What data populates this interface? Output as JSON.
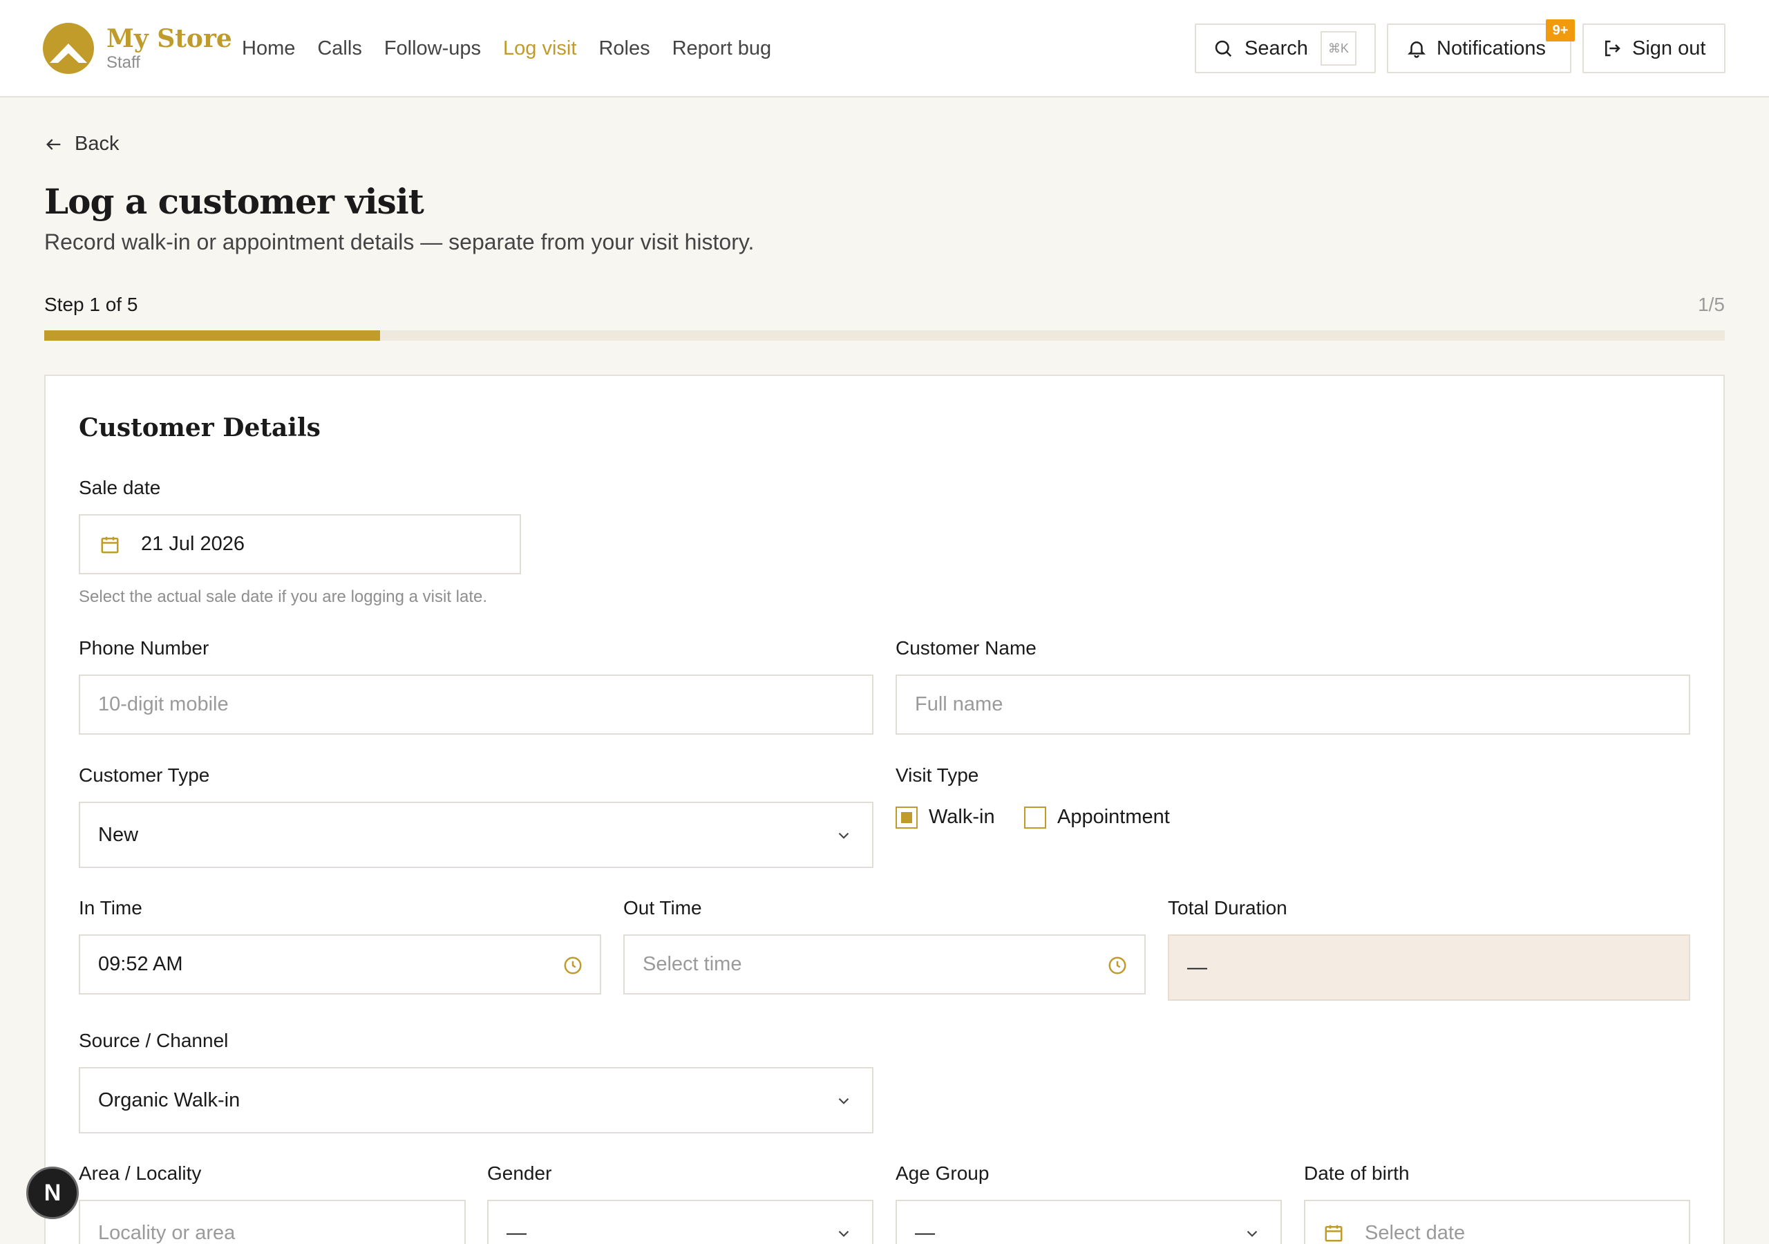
{
  "brand": {
    "name": "My Store",
    "subtitle": "Staff"
  },
  "nav": {
    "items": [
      {
        "label": "Home",
        "active": false
      },
      {
        "label": "Calls",
        "active": false
      },
      {
        "label": "Follow-ups",
        "active": false
      },
      {
        "label": "Log visit",
        "active": true
      },
      {
        "label": "Roles",
        "active": false
      },
      {
        "label": "Report bug",
        "active": false
      }
    ]
  },
  "header_actions": {
    "search_label": "Search",
    "search_shortcut": "⌘K",
    "notifications_label": "Notifications",
    "notifications_badge": "9+",
    "signout_label": "Sign out"
  },
  "page": {
    "back_label": "Back",
    "title": "Log a customer visit",
    "subtitle": "Record walk-in or appointment details — separate from your visit history.",
    "step_label": "Step 1 of 5",
    "step_count": "1/5",
    "progress_fraction": 0.2
  },
  "form": {
    "section_title": "Customer Details",
    "sale_date": {
      "label": "Sale date",
      "value": "21 Jul 2026",
      "hint": "Select the actual sale date if you are logging a visit late."
    },
    "phone": {
      "label": "Phone Number",
      "placeholder": "10-digit mobile"
    },
    "customer_name": {
      "label": "Customer Name",
      "placeholder": "Full name"
    },
    "customer_type": {
      "label": "Customer Type",
      "value": "New"
    },
    "visit_type": {
      "label": "Visit Type",
      "options": [
        {
          "label": "Walk-in",
          "checked": true
        },
        {
          "label": "Appointment",
          "checked": false
        }
      ]
    },
    "in_time": {
      "label": "In Time",
      "value": "09:52 AM"
    },
    "out_time": {
      "label": "Out Time",
      "placeholder": "Select time"
    },
    "total_duration": {
      "label": "Total Duration",
      "value": "—"
    },
    "source": {
      "label": "Source / Channel",
      "value": "Organic Walk-in"
    },
    "area": {
      "label": "Area / Locality",
      "placeholder": "Locality or area"
    },
    "gender": {
      "label": "Gender",
      "value": "—"
    },
    "age_group": {
      "label": "Age Group",
      "value": "—"
    },
    "dob": {
      "label": "Date of birth",
      "placeholder": "Select date"
    }
  },
  "dev_badge": "N",
  "colors": {
    "accent": "#bf9b2c",
    "badge": "#f29a0d",
    "background": "#f8f6f1"
  }
}
